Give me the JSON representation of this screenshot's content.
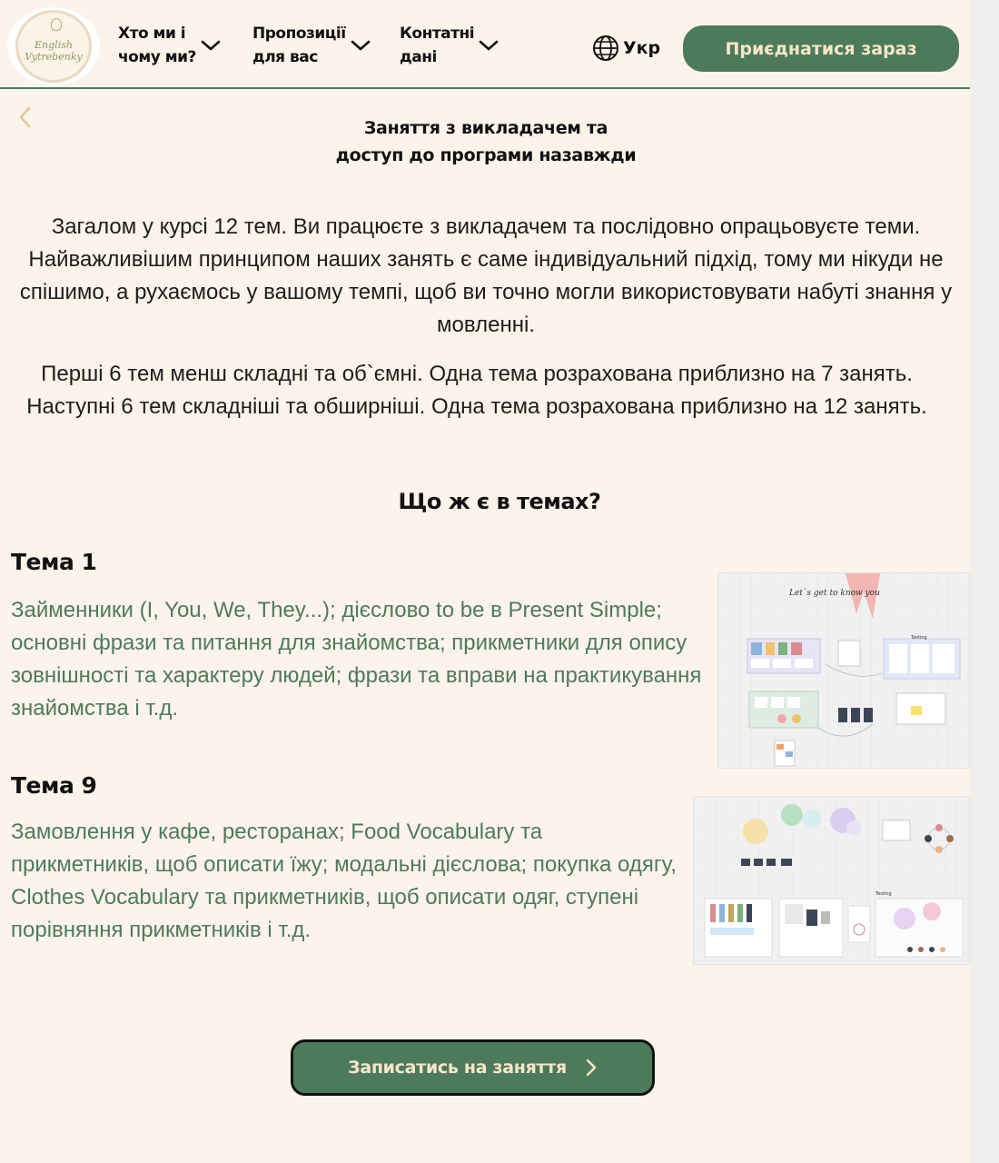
{
  "header": {
    "logo": {
      "line1": "English",
      "line2": "Vytrebenky"
    },
    "nav": [
      {
        "label": "Хто ми і\nчому ми?"
      },
      {
        "label": "Пропозиції\nдля вас"
      },
      {
        "label": "Контатні\nдані"
      }
    ],
    "language": "Укр",
    "join_label": "Приєднатися зараз"
  },
  "section": {
    "title": "Заняття з викладачем та\nдоступ до програми назавжди",
    "paragraph1": "Загалом у  курсі 12 тем. Ви працюєте з викладачем та послідовно опрацьовуєте теми. Найважливішим принципом наших занять є саме індивідуальний підхід, тому ми нікуди не спішимо, а рухаємось у вашому темпі, щоб ви точно могли використовувати набуті знання у мовленні.",
    "paragraph2": "Перші 6 тем менш складні та об`ємні. Одна тема розрахована приблизно на 7 занять. Наступні 6 тем складніші та обширніші. Одна тема розрахована приблизно на 12 занять.",
    "subheading": "Що ж є в темах?"
  },
  "topics": [
    {
      "title": "Тема 1",
      "text": "Займенники (I, You, We, They...); дієслово to be в Present Simple; основні фрази та питання для знайомства; прикметники для опису зовнішності та характеру людей; фрази та вправи на практикування знайомства і т.д.",
      "board_heading": "Let`s get to know you",
      "board_label": "Testing"
    },
    {
      "title": "Тема 9",
      "text": "Замовлення у кафе, ресторанах; Food Vocabulary та прикметників, щоб описати їжу; модальні дієслова; покупка одягу, Clothes Vocabulary та прикметників, щоб описати одяг, ступені порівняння прикметників і т.д.",
      "board_label": "Testing"
    },
    {
      "_": "placeholder"
    }
  ],
  "cta_label": "Записатись на заняття",
  "colors": {
    "page_bg": "#fcf3ea",
    "accent_green": "#4e7a5c",
    "button_text": "#f6e7c8"
  }
}
